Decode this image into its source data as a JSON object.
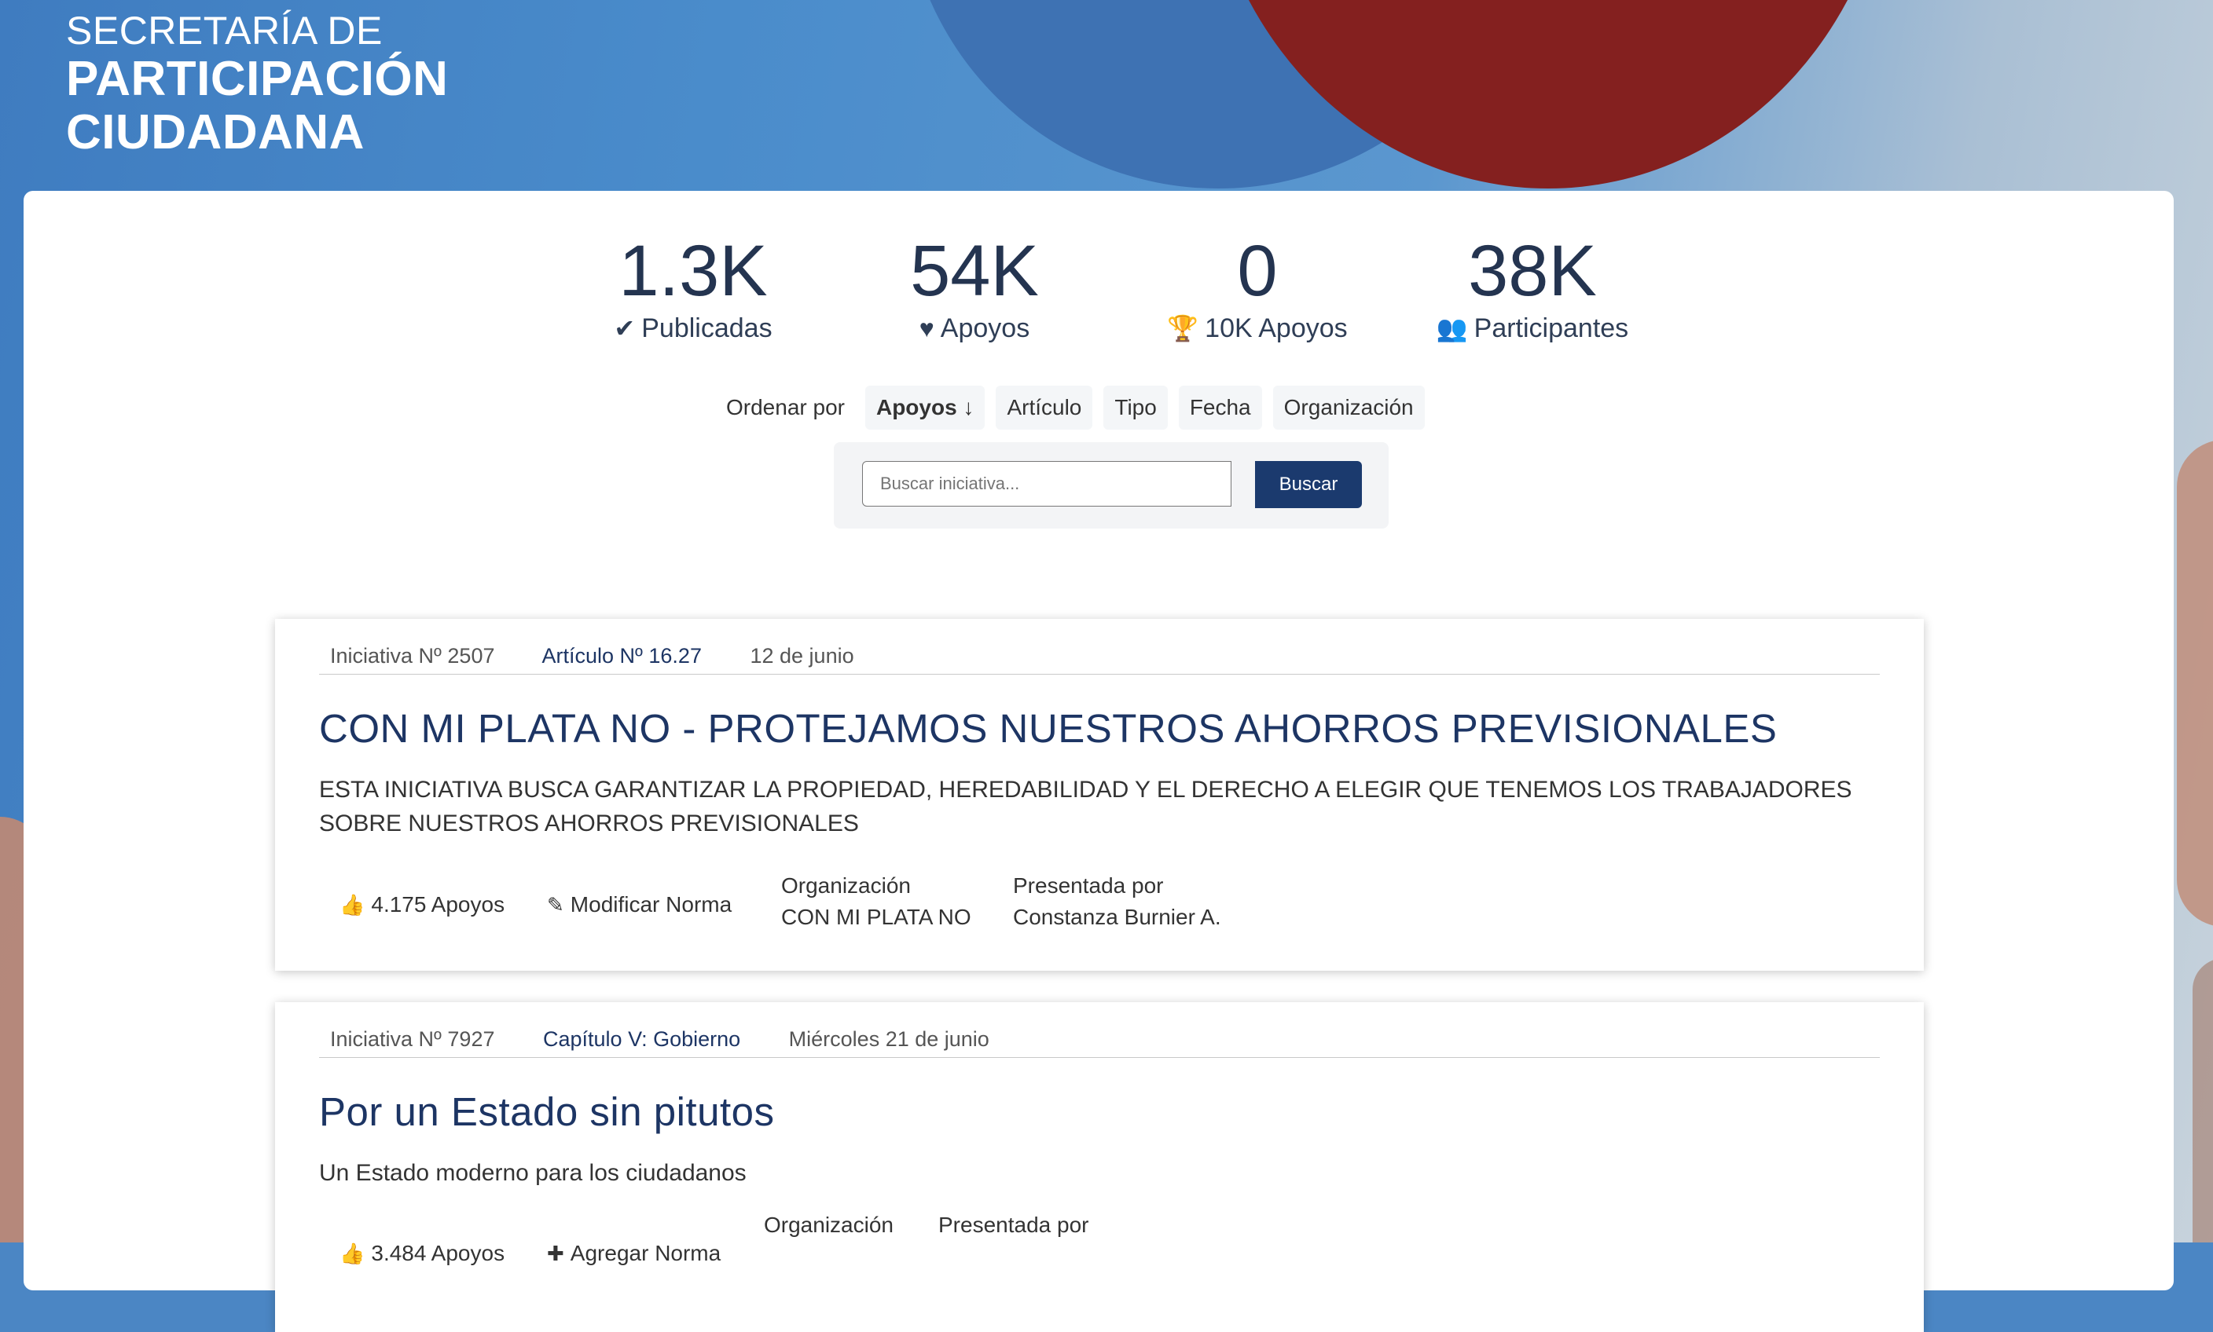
{
  "brand": {
    "line1": "SECRETARÍA DE",
    "line2": "PARTICIPACIÓN",
    "line3": "CIUDADANA"
  },
  "stats": [
    {
      "value": "1.3K",
      "label": "Publicadas",
      "icon": "check-icon"
    },
    {
      "value": "54K",
      "label": "Apoyos",
      "icon": "heart-icon"
    },
    {
      "value": "0",
      "label": "10K Apoyos",
      "icon": "trophy-icon"
    },
    {
      "value": "38K",
      "label": "Participantes",
      "icon": "users-icon"
    }
  ],
  "sort": {
    "label": "Ordenar por",
    "options": [
      "Apoyos ↓",
      "Artículo",
      "Tipo",
      "Fecha",
      "Organización"
    ],
    "active": "Apoyos ↓"
  },
  "search": {
    "placeholder": "Buscar iniciativa...",
    "button": "Buscar"
  },
  "initiatives": [
    {
      "number": "Iniciativa Nº 2507",
      "article": "Artículo Nº 16.27",
      "date": "12 de junio",
      "title": "CON MI PLATA NO - PROTEJAMOS NUESTROS AHORROS PREVISIONALES",
      "description": "ESTA INICIATIVA BUSCA GARANTIZAR LA PROPIEDAD, HEREDABILIDAD Y EL DERECHO A ELEGIR QUE TENEMOS LOS TRABAJADORES SOBRE NUESTROS AHORROS PREVISIONALES",
      "supports": "4.175 Apoyos",
      "type": "Modificar Norma",
      "org_label": "Organización",
      "org": "CON MI PLATA NO",
      "presented_label": "Presentada por",
      "presented_by": "Constanza Burnier A."
    },
    {
      "number": "Iniciativa Nº 7927",
      "article": "Capítulo V: Gobierno",
      "date": "Miércoles 21 de junio",
      "title": "Por un Estado sin pitutos",
      "description": "Un Estado moderno para los ciudadanos",
      "supports": "3.484 Apoyos",
      "type": "Agregar Norma",
      "org_label": "Organización",
      "presented_label": "Presentada por"
    }
  ],
  "colors": {
    "primary": "#1d3564",
    "button": "#1b3a6e",
    "red": "#84201f"
  }
}
